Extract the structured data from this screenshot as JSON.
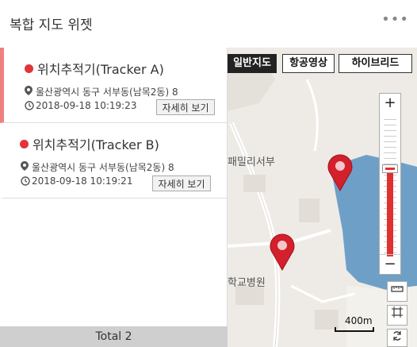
{
  "header": {
    "title": "복합 지도 위젯",
    "more_label": "•••"
  },
  "trackers": [
    {
      "name": "위치추적기(Tracker A)",
      "address": "울산광역시 동구 서부동(남목2동) 8",
      "time": "2018-09-18 10:19:23",
      "detail_label": "자세히 보기",
      "dot_color": "#e0343a"
    },
    {
      "name": "위치추적기(Tracker B)",
      "address": "울산광역시 동구 서부동(남목2동) 8",
      "time": "2018-09-18 10:19:21",
      "detail_label": "자세히 보기",
      "dot_color": "#e0343a"
    }
  ],
  "footer": {
    "total_label": "Total 2"
  },
  "map": {
    "type_buttons": {
      "normal": "일반지도",
      "satellite": "항공영상",
      "hybrid": "하이브리드"
    },
    "zoom_in": "+",
    "zoom_out": "−",
    "scale_label": "400m",
    "place_labels": {
      "place1": "패밀리서부",
      "place2": "학교병원"
    },
    "colors": {
      "marker": "#d41f2c",
      "water": "#6ea0c7",
      "zoom_track": "#e03030"
    }
  }
}
